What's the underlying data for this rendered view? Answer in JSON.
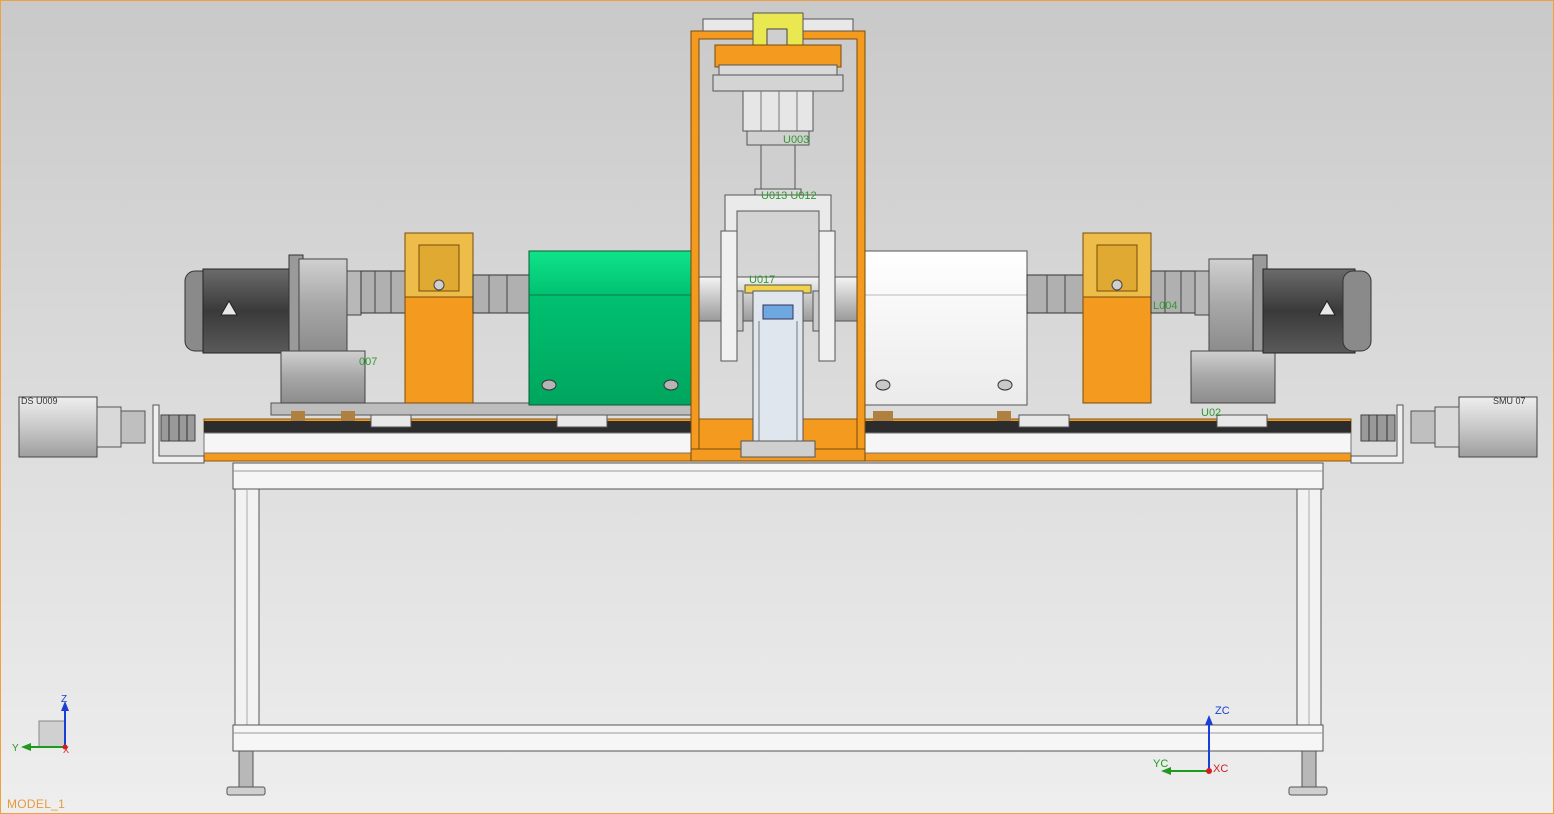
{
  "model_name": "MODEL_1",
  "part_labels": {
    "left_motor_code": "DS U009",
    "right_motor_code": "SMU 07",
    "label_007": "007",
    "label_004": "L004",
    "label_002": "U02",
    "label_003": "U003",
    "label_012": "U013 U012",
    "label_017": "U017"
  },
  "csys_main": {
    "z": "ZC",
    "y": "YC",
    "x": "XC"
  },
  "csys_view": {
    "z": "Z",
    "y": "Y",
    "x": "X"
  },
  "colors": {
    "frame_orange": "#f39a1f",
    "green_housing": "#00b96b",
    "yellow_guard": "#f2b830",
    "dark_motor": "#4a4a4a",
    "grey_housing": "#a9a9a9",
    "label_green": "#2e9a2e",
    "axis_blue": "#1a3fd6",
    "axis_green": "#1f9a1f",
    "axis_red": "#d12020"
  }
}
